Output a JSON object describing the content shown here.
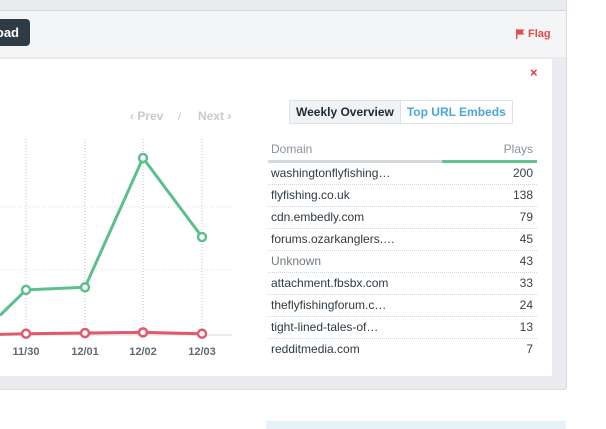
{
  "toolbar": {
    "download_label": "oad",
    "flag_label": "Flag"
  },
  "dialog": {
    "close_label": "×"
  },
  "pager": {
    "prev_label": "‹ Prev",
    "sep": "/",
    "next_label": "Next ›"
  },
  "tabs": [
    {
      "label": "Weekly Overview",
      "active": true
    },
    {
      "label": "Top URL Embeds",
      "active": false
    }
  ],
  "table": {
    "col_domain": "Domain",
    "col_plays": "Plays",
    "rows": [
      {
        "domain": "washingtonflyfishing…",
        "plays": "200"
      },
      {
        "domain": "flyfishing.co.uk",
        "plays": "138"
      },
      {
        "domain": "cdn.embedly.com",
        "plays": "79"
      },
      {
        "domain": "forums.ozarkanglers.…",
        "plays": "45"
      },
      {
        "domain": "Unknown",
        "plays": "43"
      },
      {
        "domain": "attachment.fbsbx.com",
        "plays": "33"
      },
      {
        "domain": "theflyfishingforum.c…",
        "plays": "24"
      },
      {
        "domain": "tight-lined-tales-of…",
        "plays": "13"
      },
      {
        "domain": "redditmedia.com",
        "plays": "7"
      }
    ]
  },
  "chart_data": {
    "type": "line",
    "categories": [
      "11/30",
      "12/01",
      "12/02",
      "12/03"
    ],
    "series": [
      {
        "color": "#5cc08d",
        "values": [
          69,
          73,
          271,
          150
        ],
        "lead_in": 30
      },
      {
        "color": "#e0596b",
        "values": [
          2,
          3,
          4,
          2
        ],
        "lead_in": 1
      }
    ],
    "ylim": [
      0,
      300
    ],
    "grid": true
  }
}
